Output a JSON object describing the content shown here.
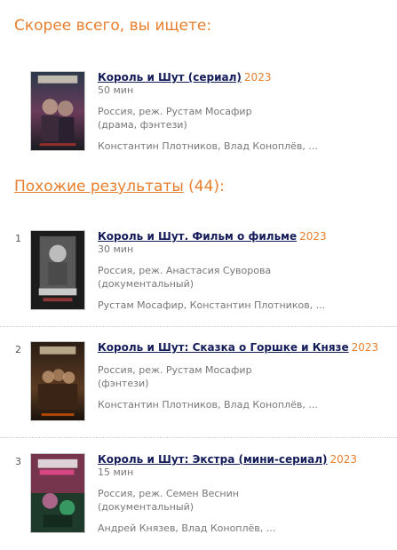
{
  "best_match": {
    "heading": "Скорее всего, вы ищете:",
    "item": {
      "title": "Король и Шут (сериал)",
      "year": "2023",
      "duration": "50 мин",
      "country_director": "Россия, реж. Рустам Мосафир",
      "genre": "(драма, фэнтези)",
      "cast": "Константин Плотников, Влад Коноплёв, ...",
      "poster_icon": "poster-image"
    }
  },
  "similar": {
    "heading_link": "Похожие результаты",
    "count": "(44):",
    "items": [
      {
        "num": "1",
        "title": "Король и Шут. Фильм о фильме",
        "year": "2023",
        "duration": "30 мин",
        "country_director": "Россия, реж. Анастасия Суворова",
        "genre": "(документальный)",
        "cast": "Рустам Мосафир, Константин Плотников, ..."
      },
      {
        "num": "2",
        "title": "Король и Шут: Сказка о Горшке и Князе",
        "year": "2023",
        "duration": "",
        "country_director": "Россия, реж. Рустам Мосафир",
        "genre": "(фэнтези)",
        "cast": "Константин Плотников, Влад Коноплёв, ..."
      },
      {
        "num": "3",
        "title": "Король и Шут: Экстра (мини-сериал)",
        "year": "2023",
        "duration": "15 мин",
        "country_director": "Россия, реж. Семен Веснин",
        "genre": "(документальный)",
        "cast": "Андрей Князев, Влад Коноплёв, ..."
      }
    ]
  },
  "colors": {
    "accent": "#e87f2e",
    "title_link": "#131b59",
    "meta_text": "#777777"
  }
}
